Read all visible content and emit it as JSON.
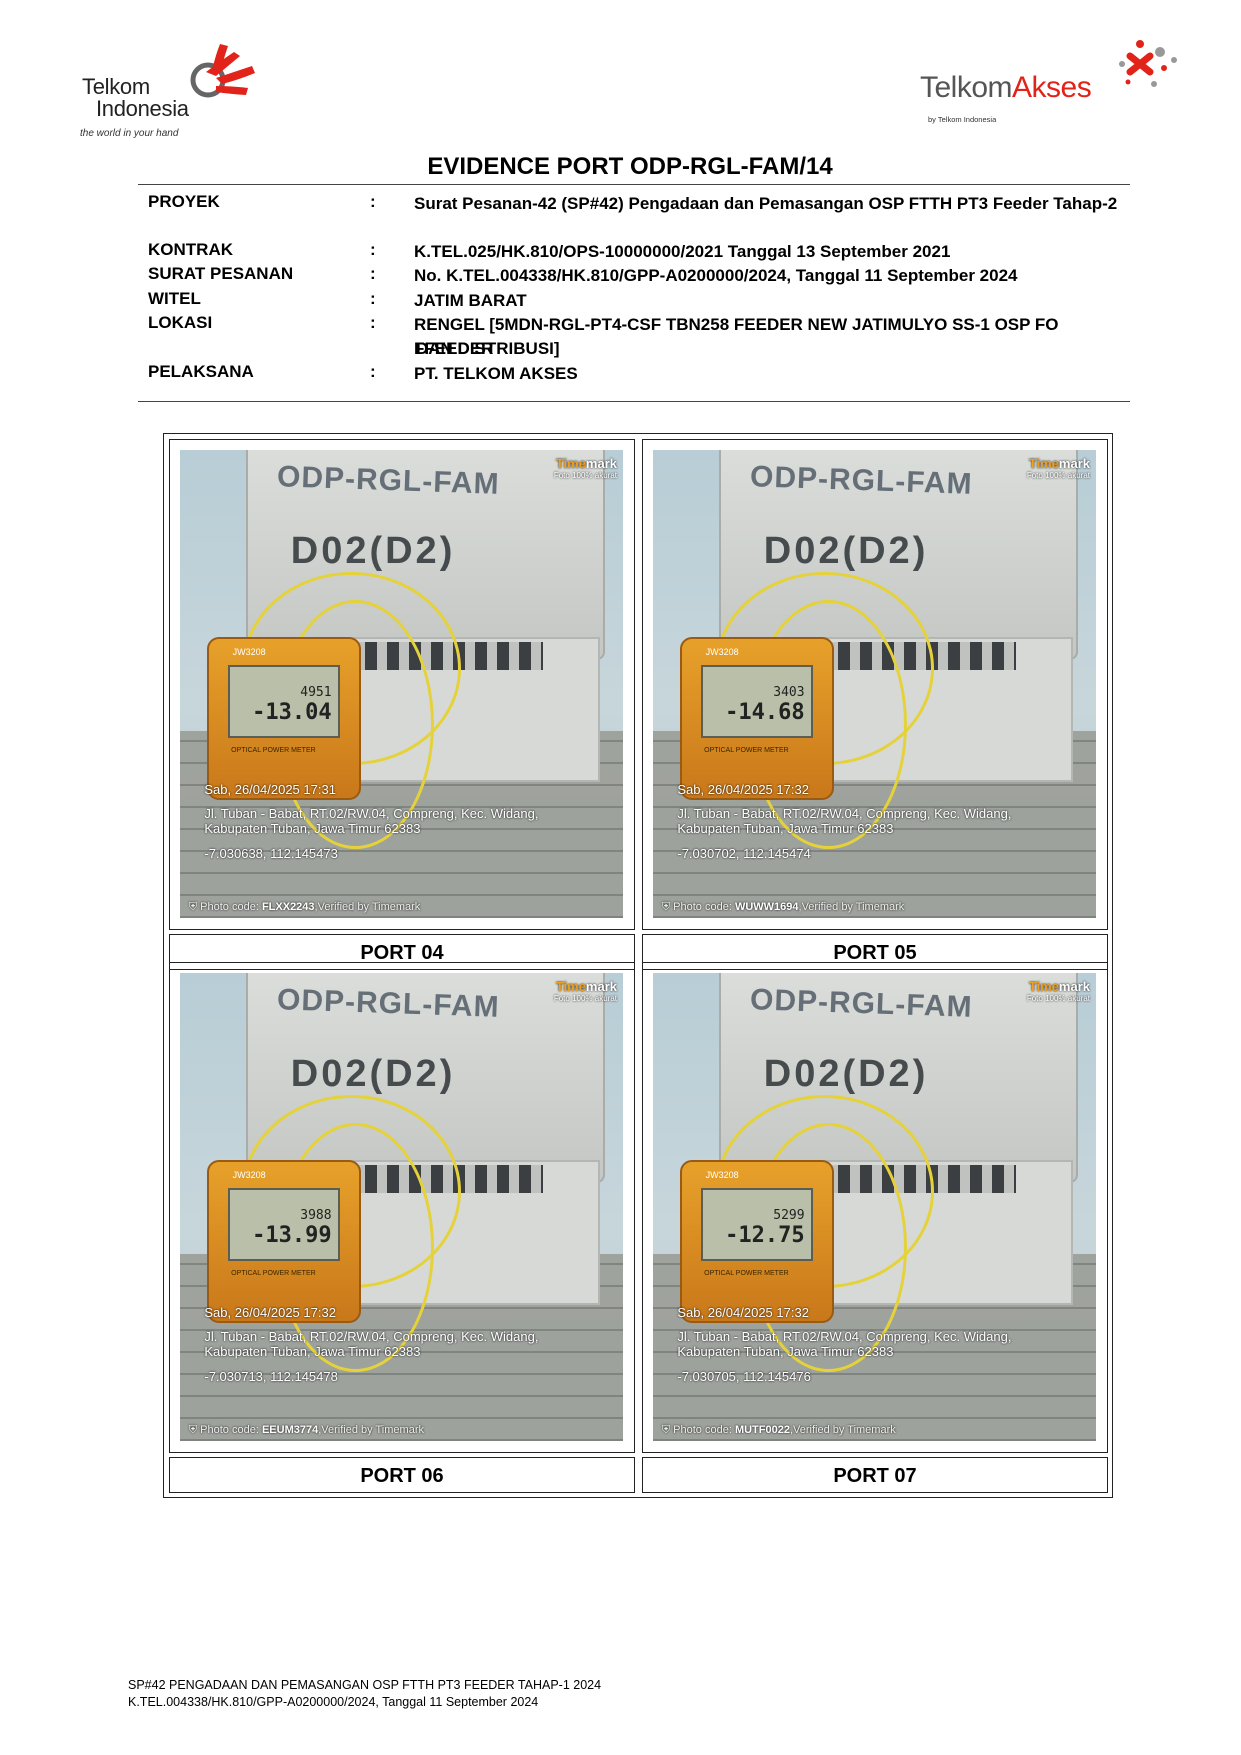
{
  "logos": {
    "left": {
      "line1": "Telkom",
      "line2": "Indonesia",
      "tagline": "the world in your hand"
    },
    "right": {
      "part1": "Telkom",
      "part2": "Akses",
      "by": "by Telkom Indonesia"
    },
    "colors": {
      "red": "#e2231a",
      "gray": "#555555"
    }
  },
  "title": "EVIDENCE PORT ODP-RGL-FAM/14",
  "info": [
    {
      "label": "PROYEK",
      "colon": ":",
      "value": "Surat Pesanan-42 (SP#42) Pengadaan dan Pemasangan OSP FTTH PT3 Feeder Tahap-2"
    },
    {
      "label": "KONTRAK",
      "colon": ":",
      "value": "K.TEL.025/HK.810/OPS-10000000/2021 Tanggal 13 September 2021"
    },
    {
      "label": "SURAT PESANAN",
      "colon": ":",
      "value": "No. K.TEL.004338/HK.810/GPP-A0200000/2024, Tanggal 11 September 2024"
    },
    {
      "label": "WITEL",
      "colon": ":",
      "value": "JATIM BARAT"
    },
    {
      "label": "LOKASI",
      "colon": ":",
      "value": "RENGEL [5MDN-RGL-PT4-CSF TBN258 FEEDER NEW JATIMULYO SS-1 OSP FO FFEEDER",
      "value2": "DAN DISTRIBUSI]"
    },
    {
      "label": "PELAKSANA",
      "colon": ":",
      "value": "PT. TELKOM AKSES"
    }
  ],
  "photos": [
    {
      "caption": "PORT 04",
      "box_label": "ODP-RGL-FAM",
      "box_code": "D02(D2)",
      "meter_model": "JW3208",
      "meter_ref": "4951",
      "meter_reading": "-13.04",
      "meter_label": "OPTICAL POWER METER",
      "datetime": "Sab, 26/04/2025 17:31",
      "address": "Jl. Tuban - Babat, RT.02/RW.04, Compreng, Kec. Widang, Kabupaten Tuban, Jawa Timur 62383",
      "coords": "-7.030638, 112.145473",
      "photo_code_prefix": "Photo code: ",
      "photo_code": "FLXX2243",
      "verified": ",Verified by Timemark",
      "watermark_a": "Time",
      "watermark_b": "mark",
      "watermark_sub": "Foto 100% akurat"
    },
    {
      "caption": "PORT 05",
      "box_label": "ODP-RGL-FAM",
      "box_code": "D02(D2)",
      "meter_model": "JW3208",
      "meter_ref": "3403",
      "meter_reading": "-14.68",
      "meter_label": "OPTICAL POWER METER",
      "datetime": "Sab, 26/04/2025 17:32",
      "address": "Jl. Tuban - Babat, RT.02/RW.04, Compreng, Kec. Widang, Kabupaten Tuban, Jawa Timur 62383",
      "coords": "-7.030702, 112.145474",
      "photo_code_prefix": "Photo code: ",
      "photo_code": "WUWW1694",
      "verified": ",Verified by Timemark",
      "watermark_a": "Time",
      "watermark_b": "mark",
      "watermark_sub": "Foto 100% akurat"
    },
    {
      "caption": "PORT 06",
      "box_label": "ODP-RGL-FAM",
      "box_code": "D02(D2)",
      "meter_model": "JW3208",
      "meter_ref": "3988",
      "meter_reading": "-13.99",
      "meter_label": "OPTICAL POWER METER",
      "datetime": "Sab, 26/04/2025 17:32",
      "address": "Jl. Tuban - Babat, RT.02/RW.04, Compreng, Kec. Widang, Kabupaten Tuban, Jawa Timur 62383",
      "coords": "-7.030713, 112.145478",
      "photo_code_prefix": "Photo code: ",
      "photo_code": "EEUM3774",
      "verified": ",Verified by Timemark",
      "watermark_a": "Time",
      "watermark_b": "mark",
      "watermark_sub": "Foto 100% akurat"
    },
    {
      "caption": "PORT 07",
      "box_label": "ODP-RGL-FAM",
      "box_code": "D02(D2)",
      "meter_model": "JW3208",
      "meter_ref": "5299",
      "meter_reading": "-12.75",
      "meter_label": "OPTICAL POWER METER",
      "datetime": "Sab, 26/04/2025 17:32",
      "address": "Jl. Tuban - Babat, RT.02/RW.04, Compreng, Kec. Widang, Kabupaten Tuban, Jawa Timur 62383",
      "coords": "-7.030705, 112.145476",
      "photo_code_prefix": "Photo code: ",
      "photo_code": "MUTF0022",
      "verified": ",Verified by Timemark",
      "watermark_a": "Time",
      "watermark_b": "mark",
      "watermark_sub": "Foto 100% akurat"
    }
  ],
  "footer": {
    "line1": "SP#42 PENGADAAN DAN PEMASANGAN OSP FTTH PT3 FEEDER TAHAP-1 2024",
    "line2": "K.TEL.004338/HK.810/GPP-A0200000/2024, Tanggal 11 September 2024"
  }
}
